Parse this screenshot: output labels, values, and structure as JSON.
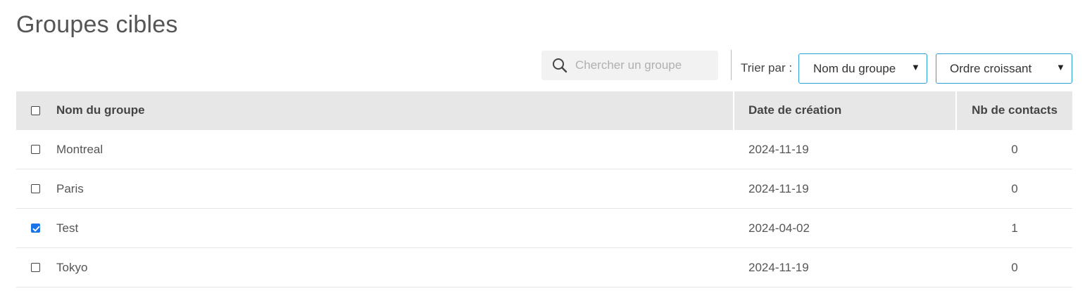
{
  "page": {
    "title": "Groupes cibles"
  },
  "search": {
    "placeholder": "Chercher un groupe",
    "icon": "search-icon"
  },
  "sort": {
    "label": "Trier par :",
    "field_selected": "Nom du groupe",
    "order_selected": "Ordre croissant"
  },
  "table": {
    "headers": {
      "name": "Nom du groupe",
      "date": "Date de création",
      "count": "Nb de contacts"
    },
    "rows": [
      {
        "name": "Montreal",
        "date": "2024-11-19",
        "count": "0",
        "checked": false
      },
      {
        "name": "Paris",
        "date": "2024-11-19",
        "count": "0",
        "checked": false
      },
      {
        "name": "Test",
        "date": "2024-04-02",
        "count": "1",
        "checked": true
      },
      {
        "name": "Tokyo",
        "date": "2024-11-19",
        "count": "0",
        "checked": false
      }
    ]
  },
  "colors": {
    "accent_border": "#2aa0d8",
    "checkbox_checked": "#1a73e8",
    "header_bg": "#e7e7e7"
  }
}
